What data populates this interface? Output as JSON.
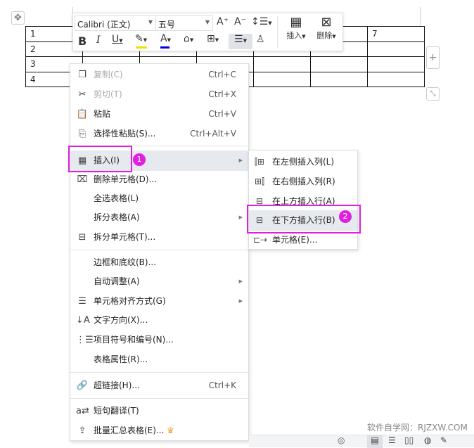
{
  "table": {
    "rows": [
      [
        "1",
        "",
        "",
        "",
        "",
        "",
        "7"
      ],
      [
        "2",
        "",
        "",
        "",
        "",
        "",
        ""
      ],
      [
        "3",
        "",
        "",
        "",
        "",
        "",
        ""
      ],
      [
        "4",
        "",
        "",
        "",
        "",
        "",
        ""
      ]
    ]
  },
  "toolbar": {
    "font": "Calibri (正文)",
    "size": "五号",
    "insert_label": "插入",
    "delete_label": "删除",
    "highlight_color": "#f0e000",
    "font_color": "#0000e0"
  },
  "menu": {
    "items": [
      {
        "label": "复制(C)",
        "shortcut": "Ctrl+C"
      },
      {
        "label": "剪切(T)",
        "shortcut": "Ctrl+X"
      },
      {
        "label": "粘贴",
        "shortcut": "Ctrl+V"
      },
      {
        "label": "选择性粘贴(S)...",
        "shortcut": "Ctrl+Alt+V"
      },
      {
        "label": "插入(I)"
      },
      {
        "label": "删除单元格(D)..."
      },
      {
        "label": "全选表格(L)"
      },
      {
        "label": "拆分表格(A)"
      },
      {
        "label": "拆分单元格(T)..."
      },
      {
        "label": "边框和底纹(B)..."
      },
      {
        "label": "自动调整(A)"
      },
      {
        "label": "单元格对齐方式(G)"
      },
      {
        "label": "文字方向(X)..."
      },
      {
        "label": "项目符号和编号(N)..."
      },
      {
        "label": "表格属性(R)..."
      },
      {
        "label": "超链接(H)...",
        "shortcut": "Ctrl+K"
      },
      {
        "label": "短句翻译(T)"
      },
      {
        "label": "批量汇总表格(E)..."
      }
    ]
  },
  "submenu": {
    "items": [
      {
        "label": "在左侧插入列(L)"
      },
      {
        "label": "在右侧插入列(R)"
      },
      {
        "label": "在上方插入行(A)"
      },
      {
        "label": "在下方插入行(B)"
      },
      {
        "label": "单元格(E)..."
      }
    ]
  },
  "annotations": {
    "step1": "1",
    "step2": "2",
    "color": "#e020e0"
  },
  "watermark": "软件自学网：RJZXW.COM"
}
